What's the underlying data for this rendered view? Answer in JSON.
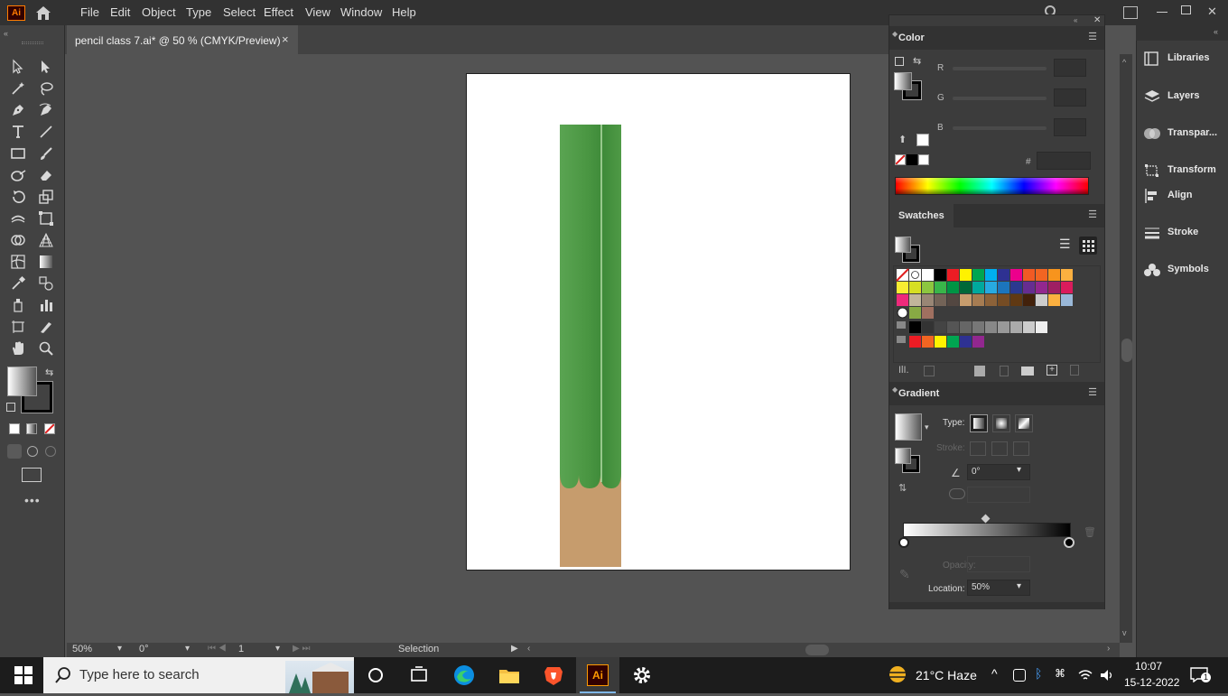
{
  "menubar": {
    "app_logo": "Ai",
    "items": [
      "File",
      "Edit",
      "Object",
      "Type",
      "Select",
      "Effect",
      "View",
      "Window",
      "Help"
    ]
  },
  "document_tab": {
    "title": "pencil class 7.ai* @ 50 % (CMYK/Preview)",
    "close": "×"
  },
  "statusbar": {
    "zoom": "50%",
    "rotation": "0°",
    "artboard": "1",
    "tool": "Selection"
  },
  "color_panel": {
    "title": "Color",
    "labels": {
      "r": "R",
      "g": "G",
      "b": "B",
      "hex": "#"
    }
  },
  "swatches_panel": {
    "title": "Swatches"
  },
  "gradient_panel": {
    "title": "Gradient",
    "type_label": "Type:",
    "stroke_label": "Stroke:",
    "angle_value": "0°",
    "opacity_label": "Opacity:",
    "location_label": "Location:",
    "location_value": "50%"
  },
  "dock": {
    "items": [
      "Libraries",
      "Layers",
      "Transpar...",
      "Transform",
      "Align",
      "Stroke",
      "Symbols"
    ]
  },
  "taskbar": {
    "search_placeholder": "Type here to search",
    "weather": "21°C  Haze",
    "time": "10:07",
    "date": "15-12-2022",
    "notifications": "1"
  },
  "colors": {
    "pencil_green": "#4e9a44",
    "pencil_wood": "#c69c6d",
    "ui_dark": "#323232",
    "ui_panel": "#3c3c3c"
  }
}
